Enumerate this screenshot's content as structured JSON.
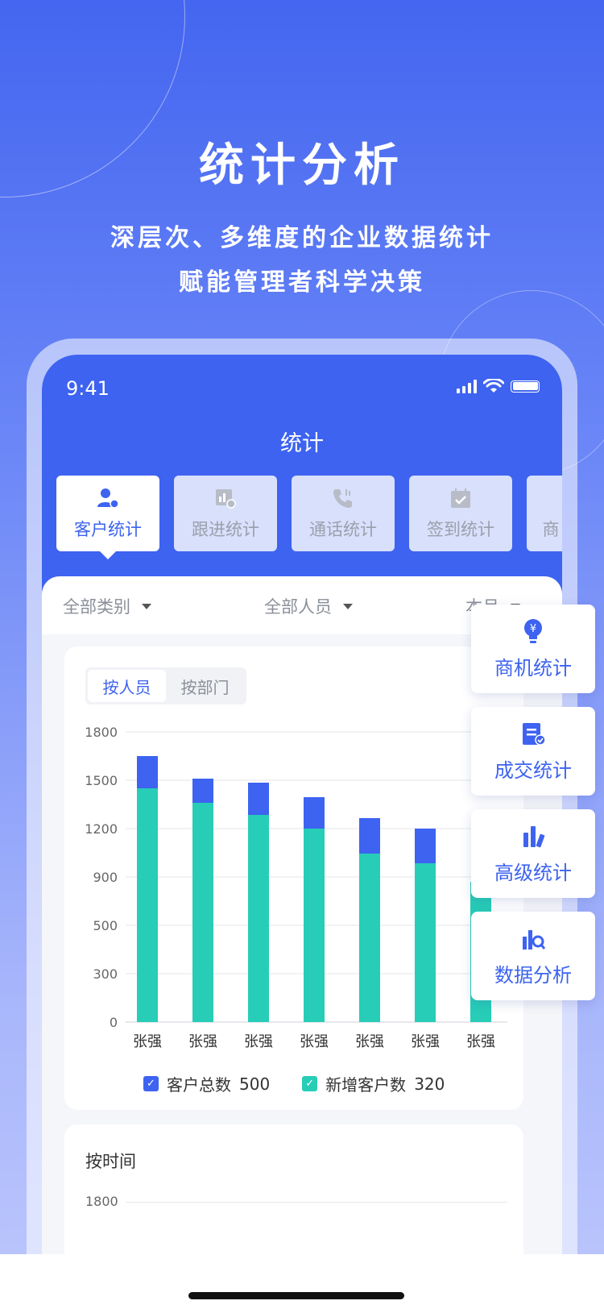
{
  "hero": {
    "title": "统计分析",
    "subtitle_line1": "深层次、多维度的企业数据统计",
    "subtitle_line2": "赋能管理者科学决策"
  },
  "status_bar": {
    "time": "9:41"
  },
  "screen": {
    "title": "统计"
  },
  "tabs": [
    {
      "label": "客户统计",
      "icon": "customer-icon",
      "active": true
    },
    {
      "label": "跟进统计",
      "icon": "followup-icon",
      "active": false
    },
    {
      "label": "通话统计",
      "icon": "phone-icon",
      "active": false
    },
    {
      "label": "签到统计",
      "icon": "checkin-icon",
      "active": false
    },
    {
      "label": "商",
      "icon": "",
      "active": false
    }
  ],
  "filters": {
    "category": "全部类别",
    "staff": "全部人员",
    "period": "本月"
  },
  "segment": {
    "by_person": "按人员",
    "by_department": "按部门"
  },
  "colors": {
    "primary": "#3d63f0",
    "teal": "#27cdb7"
  },
  "chart_data": {
    "type": "bar",
    "stacked": true,
    "categories": [
      "张强",
      "张强",
      "张强",
      "张强",
      "张强",
      "张强",
      "张强"
    ],
    "y_ticks": [
      0,
      300,
      500,
      900,
      1200,
      1500,
      1800
    ],
    "series": [
      {
        "name": "新增客户数",
        "color": "#27cdb7",
        "values": [
          1450,
          1360,
          1285,
          1200,
          1045,
          985,
          860
        ]
      },
      {
        "name": "客户总数",
        "color": "#3d63f0",
        "values": [
          200,
          150,
          200,
          195,
          220,
          215,
          0
        ]
      }
    ],
    "grid": true
  },
  "legend": {
    "items": [
      {
        "label": "客户总数",
        "value": "500"
      },
      {
        "label": "新增客户数",
        "value": "320"
      }
    ]
  },
  "card2": {
    "title": "按时间",
    "tick": "1800"
  },
  "side_menu": [
    {
      "label": "商机统计",
      "icon": "lightbulb-icon"
    },
    {
      "label": "成交统计",
      "icon": "clipboard-icon"
    },
    {
      "label": "高级统计",
      "icon": "bar-chart-icon"
    },
    {
      "label": "数据分析",
      "icon": "data-analysis-icon"
    }
  ]
}
